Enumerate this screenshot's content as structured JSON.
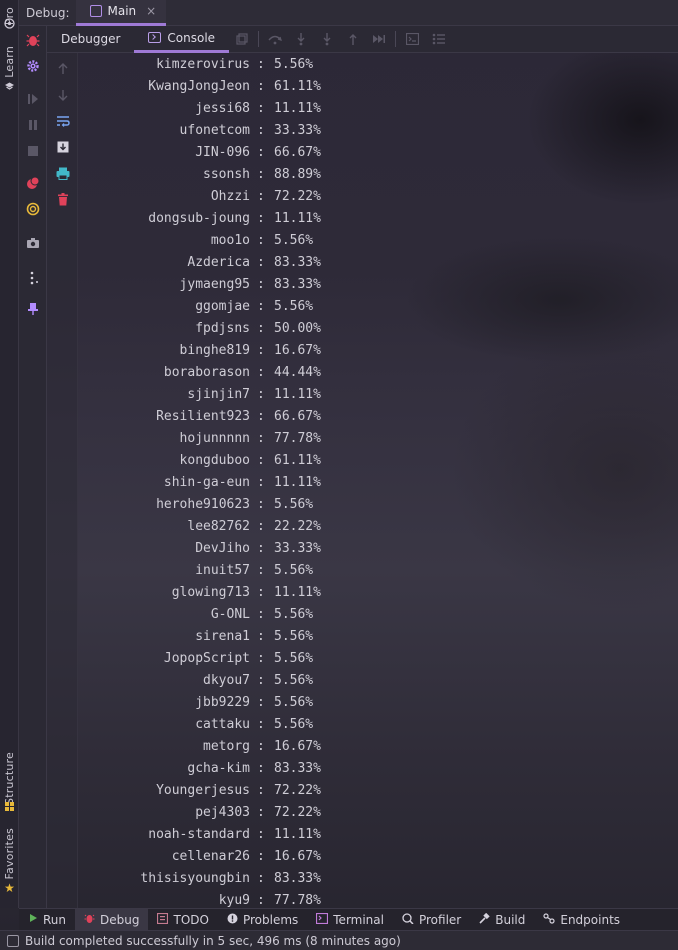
{
  "left_strip": {
    "project_label": "Pro",
    "learn_label": "Learn",
    "structure_label": "Structure",
    "favorites_label": "Favorites"
  },
  "header": {
    "debug_label": "Debug:",
    "tab_label": "Main",
    "close_glyph": "×"
  },
  "toolbar": {
    "debugger_label": "Debugger",
    "console_label": "Console"
  },
  "console": {
    "lines": [
      {
        "user": "kimzerovirus",
        "pct": "5.56%"
      },
      {
        "user": "KwangJongJeon",
        "pct": "61.11%"
      },
      {
        "user": "jessi68",
        "pct": "11.11%"
      },
      {
        "user": "ufonetcom",
        "pct": "33.33%"
      },
      {
        "user": "JIN-096",
        "pct": "66.67%"
      },
      {
        "user": "ssonsh",
        "pct": "88.89%"
      },
      {
        "user": "Ohzzi",
        "pct": "72.22%"
      },
      {
        "user": "dongsub-joung",
        "pct": "11.11%"
      },
      {
        "user": "moo1o",
        "pct": "5.56%"
      },
      {
        "user": "Azderica",
        "pct": "83.33%"
      },
      {
        "user": "jymaeng95",
        "pct": "83.33%"
      },
      {
        "user": "ggomjae",
        "pct": "5.56%"
      },
      {
        "user": "fpdjsns",
        "pct": "50.00%"
      },
      {
        "user": "binghe819",
        "pct": "16.67%"
      },
      {
        "user": "boraborason",
        "pct": "44.44%"
      },
      {
        "user": "sjinjin7",
        "pct": "11.11%"
      },
      {
        "user": "Resilient923",
        "pct": "66.67%"
      },
      {
        "user": "hojunnnnn",
        "pct": "77.78%"
      },
      {
        "user": "kongduboo",
        "pct": "61.11%"
      },
      {
        "user": "shin-ga-eun",
        "pct": "11.11%"
      },
      {
        "user": "herohe910623",
        "pct": "5.56%"
      },
      {
        "user": "lee82762",
        "pct": "22.22%"
      },
      {
        "user": "DevJiho",
        "pct": "33.33%"
      },
      {
        "user": "inuit57",
        "pct": "5.56%"
      },
      {
        "user": "glowing713",
        "pct": "11.11%"
      },
      {
        "user": "G-ONL",
        "pct": "5.56%"
      },
      {
        "user": "sirena1",
        "pct": "5.56%"
      },
      {
        "user": "JopopScript",
        "pct": "5.56%"
      },
      {
        "user": "dkyou7",
        "pct": "5.56%"
      },
      {
        "user": "jbb9229",
        "pct": "5.56%"
      },
      {
        "user": "cattaku",
        "pct": "5.56%"
      },
      {
        "user": "metorg",
        "pct": "16.67%"
      },
      {
        "user": "gcha-kim",
        "pct": "83.33%"
      },
      {
        "user": "Youngerjesus",
        "pct": "72.22%"
      },
      {
        "user": "pej4303",
        "pct": "72.22%"
      },
      {
        "user": "noah-standard",
        "pct": "11.11%"
      },
      {
        "user": "cellenar26",
        "pct": "16.67%"
      },
      {
        "user": "thisisyoungbin",
        "pct": "83.33%"
      },
      {
        "user": "kyu9",
        "pct": "77.78%"
      }
    ],
    "separator": ":"
  },
  "bottom_tabs": [
    {
      "label": "Run",
      "icon": "run-icon",
      "active": false
    },
    {
      "label": "Debug",
      "icon": "bug-icon",
      "active": true
    },
    {
      "label": "TODO",
      "icon": "todo-icon",
      "active": false
    },
    {
      "label": "Problems",
      "icon": "problems-icon",
      "active": false
    },
    {
      "label": "Terminal",
      "icon": "terminal-icon",
      "active": false
    },
    {
      "label": "Profiler",
      "icon": "profiler-icon",
      "active": false
    },
    {
      "label": "Build",
      "icon": "build-icon",
      "active": false
    },
    {
      "label": "Endpoints",
      "icon": "endpoints-icon",
      "active": false
    }
  ],
  "statusbar": {
    "message": "Build completed successfully in 5 sec, 496 ms (8 minutes ago)"
  },
  "colors": {
    "accent": "#9f7ad6",
    "resume": "#5f9e5a",
    "stop": "#e0425a",
    "mute": "#e8b93a",
    "settings": "#b38cff",
    "teal": "#42b8c9"
  }
}
